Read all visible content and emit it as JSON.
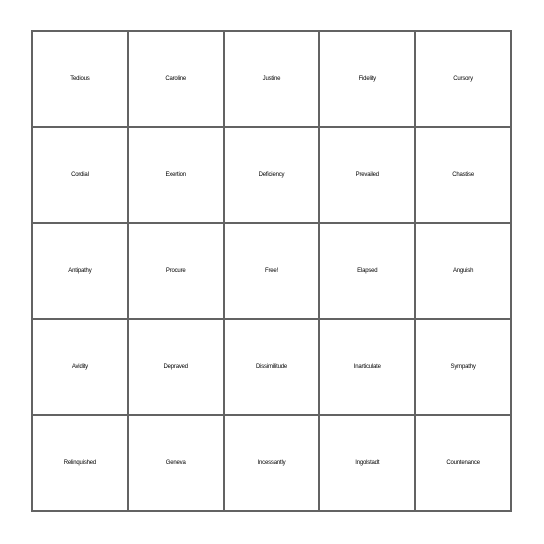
{
  "card": {
    "type": "bingo-card",
    "columns": 5,
    "rows": 5,
    "border_color": "#636363",
    "background_color": "#ffffff",
    "text_color": "#000000",
    "free_space": {
      "row": 3,
      "column": 3,
      "label": "Free!"
    },
    "cells": [
      [
        {
          "text": "Tedious",
          "size": "lg"
        },
        {
          "text": "Caroline",
          "size": "md"
        },
        {
          "text": "Justine",
          "size": "xl"
        },
        {
          "text": "Fidelity",
          "size": "xl"
        },
        {
          "text": "Cursory",
          "size": "xl"
        }
      ],
      [
        {
          "text": "Cordial",
          "size": "xl"
        },
        {
          "text": "Exertion",
          "size": "lg"
        },
        {
          "text": "Deficiency",
          "size": "sm"
        },
        {
          "text": "Prevailed",
          "size": "md"
        },
        {
          "text": "Chastise",
          "size": "md"
        }
      ],
      [
        {
          "text": "Antipathy",
          "size": "sm"
        },
        {
          "text": "Procure",
          "size": "lg"
        },
        {
          "text": "Free!",
          "size": "free"
        },
        {
          "text": "Elapsed",
          "size": "lg"
        },
        {
          "text": "Anguish",
          "size": "lg"
        }
      ],
      [
        {
          "text": "Avidity",
          "size": "xl"
        },
        {
          "text": "Depraved",
          "size": "md"
        },
        {
          "text": "Dissimilitude",
          "size": "xxs"
        },
        {
          "text": "Inarticulate",
          "size": "xs"
        },
        {
          "text": "Sympathy",
          "size": "md"
        }
      ],
      [
        {
          "text": "Relinquished",
          "size": "xxs"
        },
        {
          "text": "Geneva",
          "size": "xl"
        },
        {
          "text": "Incessantly",
          "size": "xs"
        },
        {
          "text": "Ingolstadt",
          "size": "md"
        },
        {
          "text": "Countenance",
          "size": "xxs"
        }
      ]
    ]
  }
}
